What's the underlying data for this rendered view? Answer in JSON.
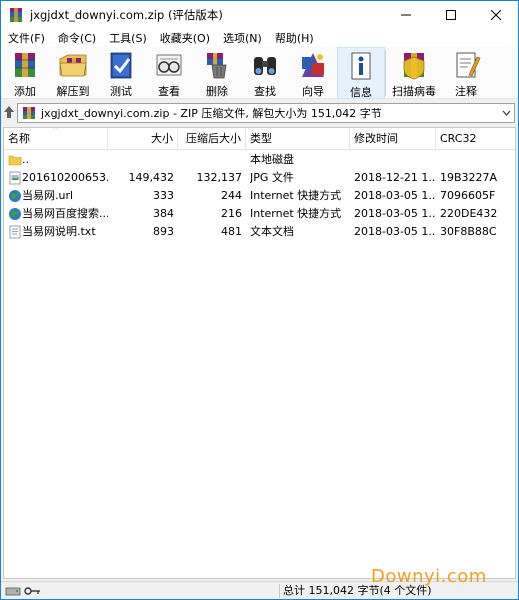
{
  "window": {
    "title": "jxgjdxt_downyi.com.zip (评估版本)",
    "controls": [
      "minimize-icon",
      "maximize-icon",
      "close-icon"
    ]
  },
  "menu": [
    {
      "label": "文件(F)"
    },
    {
      "label": "命令(C)"
    },
    {
      "label": "工具(S)"
    },
    {
      "label": "收藏夹(O)"
    },
    {
      "label": "选项(N)"
    },
    {
      "label": "帮助(H)"
    }
  ],
  "toolbar": [
    {
      "label": "添加",
      "icon": "add-archive-icon"
    },
    {
      "label": "解压到",
      "icon": "extract-to-icon"
    },
    {
      "label": "测试",
      "icon": "test-icon"
    },
    {
      "label": "查看",
      "icon": "view-icon"
    },
    {
      "label": "删除",
      "icon": "delete-icon"
    },
    {
      "label": "查找",
      "icon": "find-icon"
    },
    {
      "label": "向导",
      "icon": "wizard-icon"
    },
    {
      "label": "信息",
      "icon": "info-icon"
    },
    {
      "label": "扫描病毒",
      "icon": "virus-scan-icon"
    },
    {
      "label": "注释",
      "icon": "comment-icon"
    }
  ],
  "address": {
    "text": "jxgjdxt_downyi.com.zip - ZIP 压缩文件, 解包大小为 151,042 字节"
  },
  "columns": [
    {
      "label": "名称"
    },
    {
      "label": "大小"
    },
    {
      "label": "压缩后大小"
    },
    {
      "label": "类型"
    },
    {
      "label": "修改时间"
    },
    {
      "label": "CRC32"
    }
  ],
  "rows": [
    {
      "name": "..",
      "size": "",
      "packed": "",
      "type": "本地磁盘",
      "modified": "",
      "crc": "",
      "icon": "folder-icon"
    },
    {
      "name": "201610200653...",
      "size": "149,432",
      "packed": "132,137",
      "type": "JPG 文件",
      "modified": "2018-12-21 1...",
      "crc": "19B3227A",
      "icon": "image-file-icon"
    },
    {
      "name": "当易网.url",
      "size": "333",
      "packed": "244",
      "type": "Internet 快捷方式",
      "modified": "2018-03-05 1...",
      "crc": "7096605F",
      "icon": "internet-shortcut-icon"
    },
    {
      "name": "当易网百度搜索...",
      "size": "384",
      "packed": "216",
      "type": "Internet 快捷方式",
      "modified": "2018-03-05 1...",
      "crc": "220DE432",
      "icon": "internet-shortcut-icon"
    },
    {
      "name": "当易网说明.txt",
      "size": "893",
      "packed": "481",
      "type": "文本文档",
      "modified": "2018-03-05 1...",
      "crc": "30F8B88C",
      "icon": "text-file-icon"
    }
  ],
  "status": {
    "total": "总计 151,042 字节(4 个文件)"
  },
  "watermark": "Downyi.com"
}
